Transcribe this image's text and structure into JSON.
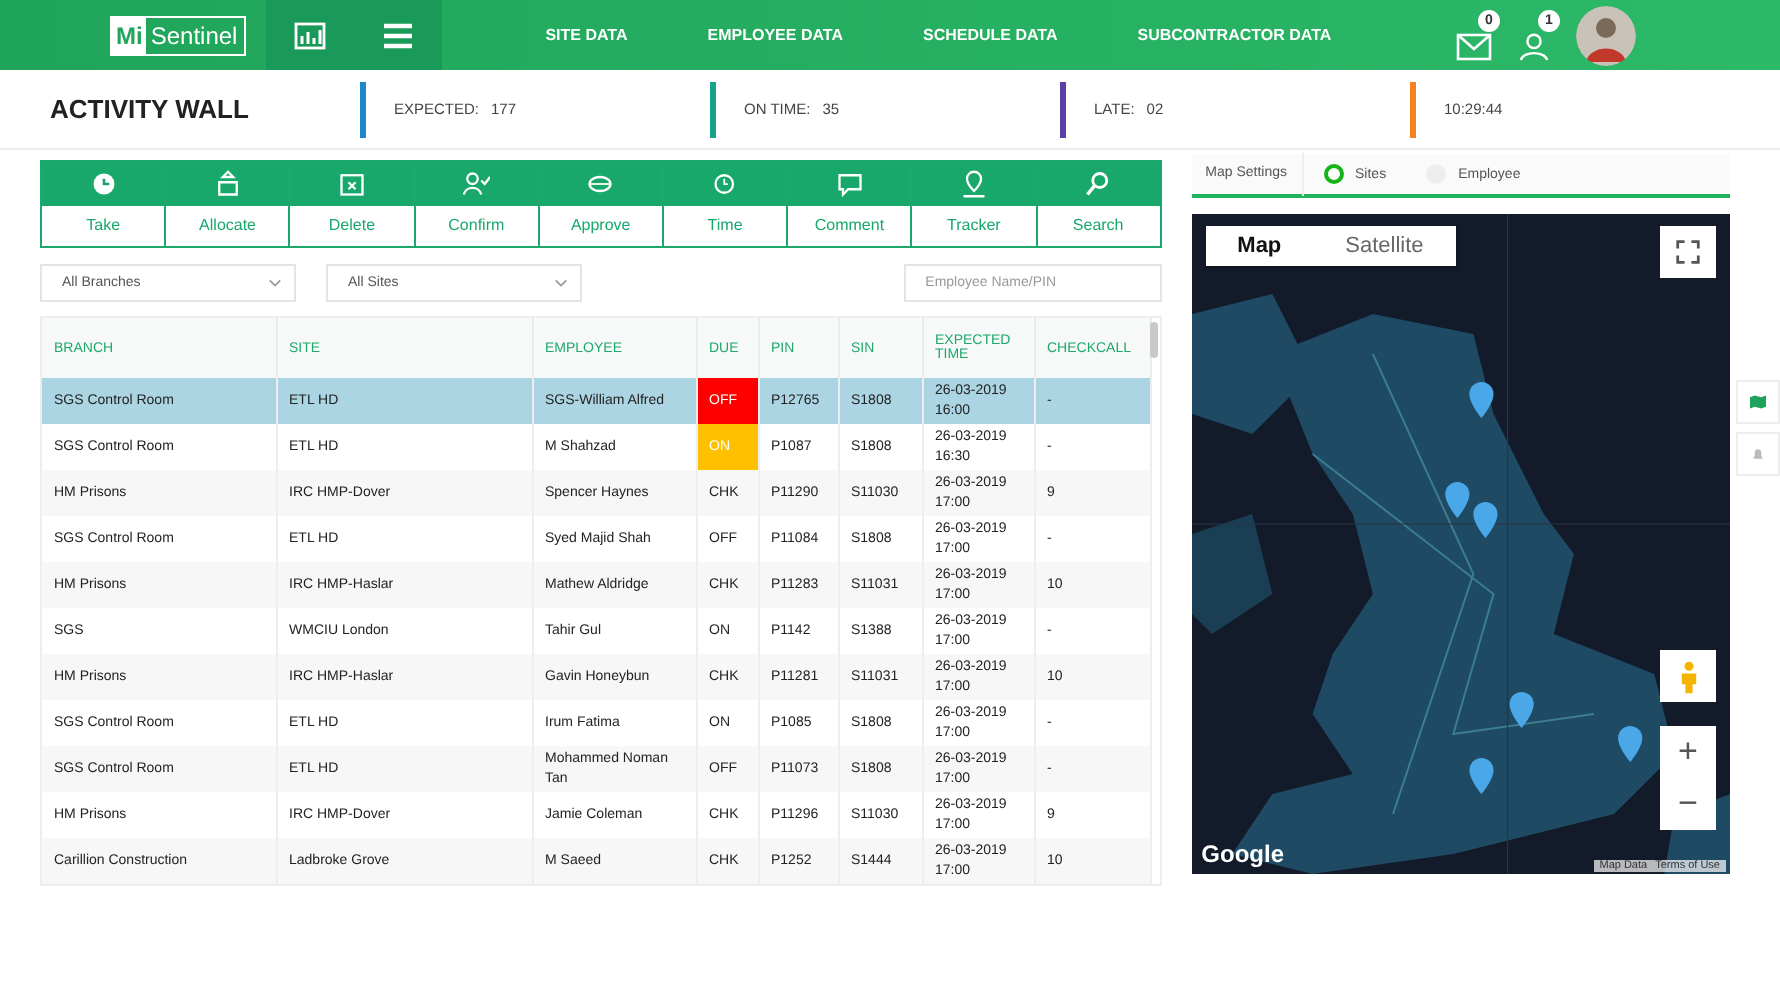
{
  "header": {
    "logo": {
      "badge": "Mi",
      "text": "Sentinel"
    },
    "nav": [
      "SITE DATA",
      "EMPLOYEE DATA",
      "SCHEDULE DATA",
      "SUBCONTRACTOR DATA"
    ],
    "mail_count": "0",
    "alerts_count": "1"
  },
  "activity": {
    "title": "ACTIVITY WALL",
    "stats": [
      {
        "label": "EXPECTED:",
        "value": "177",
        "color": "#1e88c8"
      },
      {
        "label": "ON TIME:",
        "value": "35",
        "color": "#17a38a"
      },
      {
        "label": "LATE:",
        "value": "02",
        "color": "#5b3fa6"
      },
      {
        "value": "10:29:44",
        "color": "#f58220"
      }
    ]
  },
  "actions": [
    "Take",
    "Allocate",
    "Delete",
    "Confirm",
    "Approve",
    "Time",
    "Comment",
    "Tracker",
    "Search"
  ],
  "filters": {
    "branch": "All Branches",
    "site": "All Sites",
    "search_placeholder": "Employee Name/PIN"
  },
  "table": {
    "columns": [
      "BRANCH",
      "SITE",
      "EMPLOYEE",
      "DUE",
      "PIN",
      "SIN",
      "EXPECTED TIME",
      "CHECKCALL"
    ],
    "rows": [
      {
        "selected": true,
        "color": "#ff0000",
        "cells": [
          "SGS Control Room",
          "ETL HD",
          "SGS-William Alfred",
          "OFF",
          "P12765",
          "S1808",
          "26-03-2019 16:00",
          "-"
        ]
      },
      {
        "selected": false,
        "color": "#ffc000",
        "cells": [
          "SGS Control Room",
          "ETL HD",
          "M Shahzad",
          "ON",
          "P1087",
          "S1808",
          "26-03-2019 16:30",
          "-"
        ]
      },
      {
        "selected": false,
        "cells": [
          "HM Prisons",
          "IRC HMP-Dover",
          "Spencer Haynes",
          "CHK",
          "P11290",
          "S11030",
          "26-03-2019 17:00",
          "9"
        ]
      },
      {
        "selected": false,
        "cells": [
          "SGS Control Room",
          "ETL HD",
          "Syed Majid Shah",
          "OFF",
          "P11084",
          "S1808",
          "26-03-2019 17:00",
          "-"
        ]
      },
      {
        "selected": false,
        "cells": [
          "HM Prisons",
          "IRC HMP-Haslar",
          "Mathew Aldridge",
          "CHK",
          "P11283",
          "S11031",
          "26-03-2019 17:00",
          "10"
        ]
      },
      {
        "selected": false,
        "cells": [
          "SGS",
          "WMCIU London",
          "Tahir Gul",
          "ON",
          "P1142",
          "S1388",
          "26-03-2019 17:00",
          "-"
        ]
      },
      {
        "selected": false,
        "cells": [
          "HM Prisons",
          "IRC HMP-Haslar",
          "Gavin Honeybun",
          "CHK",
          "P11281",
          "S11031",
          "26-03-2019 17:00",
          "10"
        ]
      },
      {
        "selected": false,
        "cells": [
          "SGS Control Room",
          "ETL HD",
          "Irum Fatima",
          "ON",
          "P1085",
          "S1808",
          "26-03-2019 17:00",
          "-"
        ]
      },
      {
        "selected": false,
        "cells": [
          "SGS Control Room",
          "ETL HD",
          "Mohammed Noman Tan",
          "OFF",
          "P11073",
          "S1808",
          "26-03-2019 17:00",
          "-"
        ]
      },
      {
        "selected": false,
        "cells": [
          "HM Prisons",
          "IRC HMP-Dover",
          "Jamie Coleman",
          "CHK",
          "P11296",
          "S11030",
          "26-03-2019 17:00",
          "9"
        ]
      },
      {
        "selected": false,
        "cells": [
          "Carillion Construction",
          "Ladbroke Grove",
          "M Saeed",
          "CHK",
          "P1252",
          "S1444",
          "26-03-2019 17:00",
          "10"
        ]
      }
    ]
  },
  "map_settings": {
    "label": "Map Settings",
    "options": [
      {
        "label": "Sites",
        "selected": true
      },
      {
        "label": "Employee",
        "selected": false
      }
    ]
  },
  "map": {
    "types": [
      {
        "label": "Map",
        "selected": true
      },
      {
        "label": "Satellite",
        "selected": false
      }
    ],
    "zoom_in": "+",
    "zoom_out": "−",
    "brand": "Google",
    "attribution": [
      "Map Data",
      "Terms of Use"
    ]
  }
}
